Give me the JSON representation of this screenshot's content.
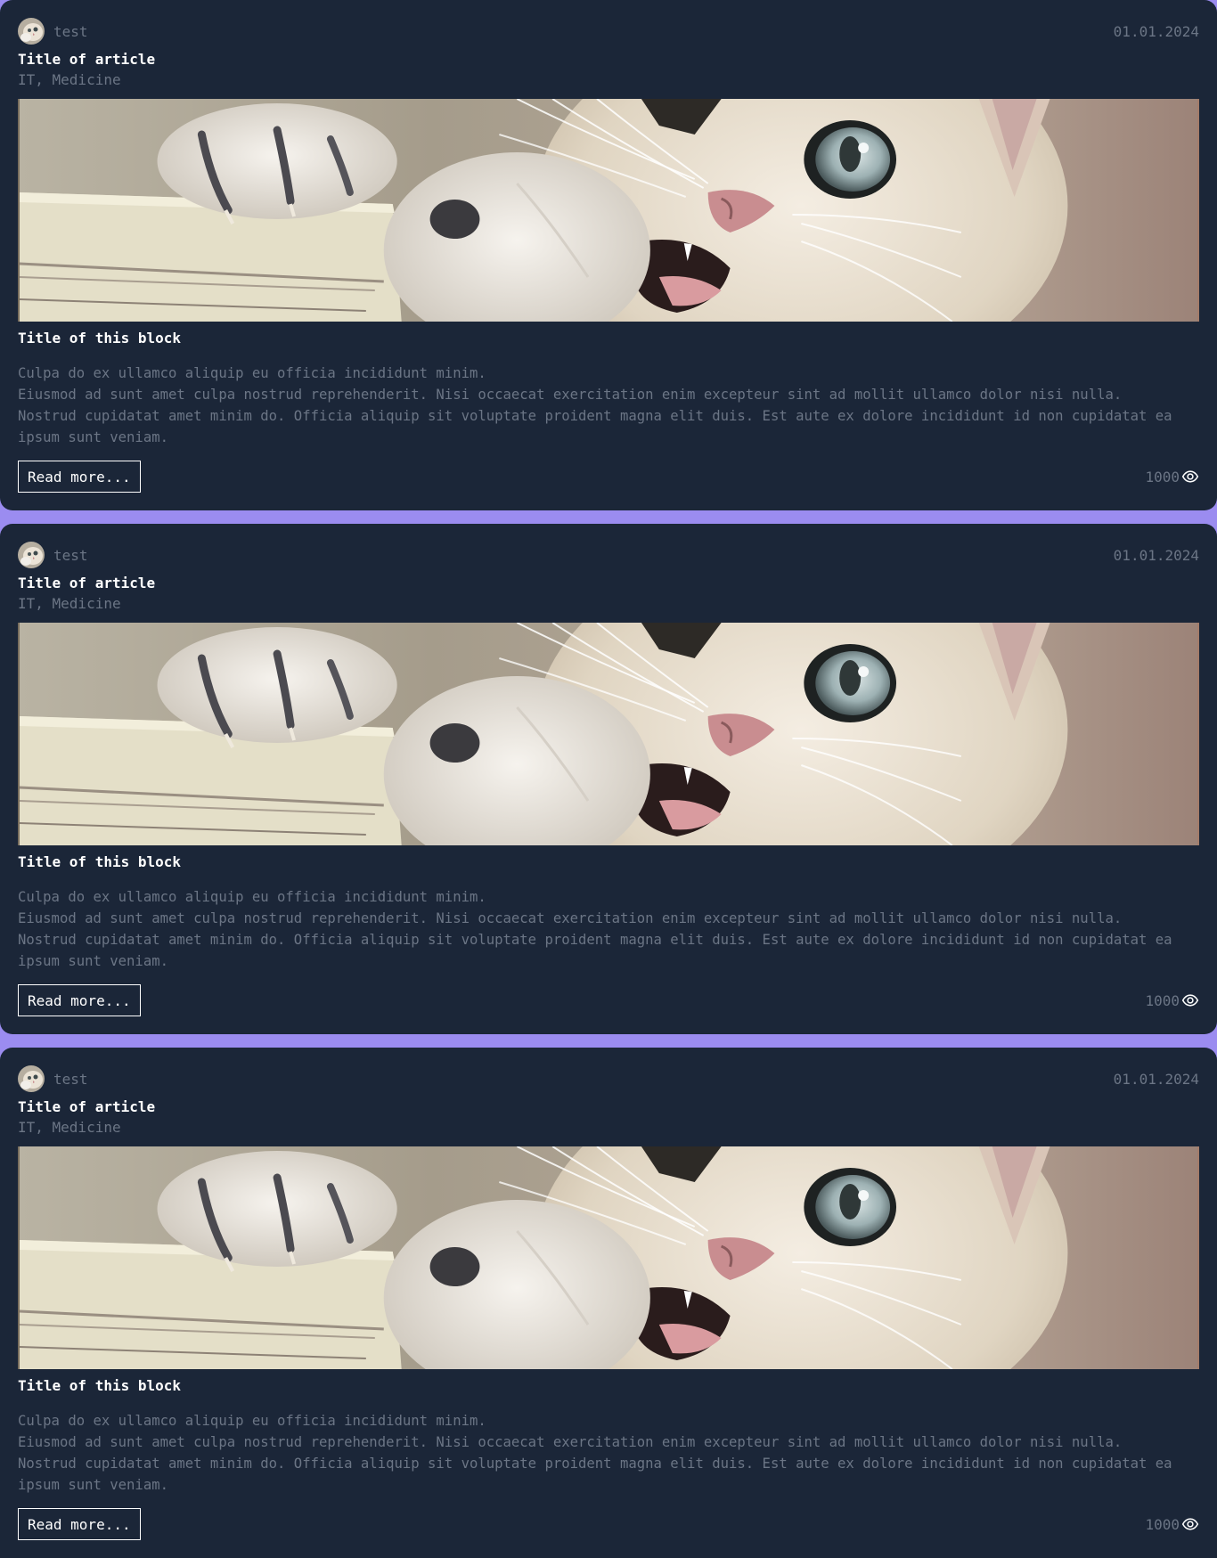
{
  "articles": [
    {
      "author": "test",
      "date": "01.01.2024",
      "title": "Title of article",
      "tags": "IT, Medicine",
      "block_title": "Title of this block",
      "paragraphs": [
        "Culpa do ex ullamco aliquip eu officia incididunt minim.",
        "Eiusmod ad sunt amet culpa nostrud reprehenderit. Nisi occaecat exercitation enim excepteur sint ad mollit ullamco dolor nisi nulla.",
        "Nostrud cupidatat amet minim do. Officia aliquip sit voluptate proident magna elit duis. Est aute ex dolore incididunt id non cupidatat ea",
        "ipsum sunt veniam."
      ],
      "read_more_label": "Read more...",
      "views": "1000"
    },
    {
      "author": "test",
      "date": "01.01.2024",
      "title": "Title of article",
      "tags": "IT, Medicine",
      "block_title": "Title of this block",
      "paragraphs": [
        "Culpa do ex ullamco aliquip eu officia incididunt minim.",
        "Eiusmod ad sunt amet culpa nostrud reprehenderit. Nisi occaecat exercitation enim excepteur sint ad mollit ullamco dolor nisi nulla.",
        "Nostrud cupidatat amet minim do. Officia aliquip sit voluptate proident magna elit duis. Est aute ex dolore incididunt id non cupidatat ea",
        "ipsum sunt veniam."
      ],
      "read_more_label": "Read more...",
      "views": "1000"
    },
    {
      "author": "test",
      "date": "01.01.2024",
      "title": "Title of article",
      "tags": "IT, Medicine",
      "block_title": "Title of this block",
      "paragraphs": [
        "Culpa do ex ullamco aliquip eu officia incididunt minim.",
        "Eiusmod ad sunt amet culpa nostrud reprehenderit. Nisi occaecat exercitation enim excepteur sint ad mollit ullamco dolor nisi nulla.",
        "Nostrud cupidatat amet minim do. Officia aliquip sit voluptate proident magna elit duis. Est aute ex dolore incididunt id non cupidatat ea",
        "ipsum sunt veniam."
      ],
      "read_more_label": "Read more...",
      "views": "1000"
    }
  ],
  "colors": {
    "page_background": "#9b8cf0",
    "card_background": "#1b2638",
    "muted_text": "#6b7585",
    "primary_text": "#ffffff"
  },
  "icons": {
    "views": "eye-icon",
    "avatar": "cat-avatar",
    "banner": "kitten-photo"
  }
}
